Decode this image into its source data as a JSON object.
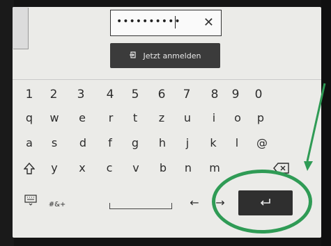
{
  "password": {
    "masked": "••••••••••"
  },
  "buttons": {
    "login": "Jetzt anmelden"
  },
  "keyboard": {
    "row1": [
      "1",
      "2",
      "3",
      "4",
      "5",
      "6",
      "7",
      "8",
      "9",
      "0"
    ],
    "row2": [
      "q",
      "w",
      "e",
      "r",
      "t",
      "z",
      "u",
      "i",
      "o",
      "p"
    ],
    "row3": [
      "a",
      "s",
      "d",
      "f",
      "g",
      "h",
      "j",
      "k",
      "l",
      "@"
    ],
    "row4": [
      "y",
      "x",
      "c",
      "v",
      "b",
      "n",
      "m"
    ],
    "symbols_label": "#&+"
  },
  "icons": {
    "clear": "close-icon",
    "login": "login-icon",
    "shift": "shift-icon",
    "backspace": "backspace-icon",
    "keyboard": "keyboard-icon",
    "enter": "enter-icon"
  },
  "annotation": {
    "color": "#2f9b55"
  }
}
